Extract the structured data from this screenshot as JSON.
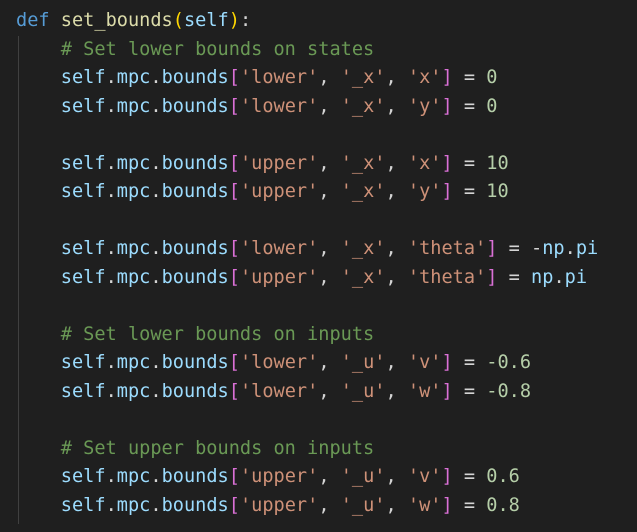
{
  "lines": [
    {
      "tokens": [
        {
          "text": "def",
          "type": "kw"
        },
        {
          "text": " ",
          "type": "plain"
        },
        {
          "text": "set_bounds",
          "type": "fn"
        },
        {
          "text": "(",
          "type": "bracket1"
        },
        {
          "text": "self",
          "type": "var"
        },
        {
          "text": ")",
          "type": "bracket1"
        },
        {
          "text": ":",
          "type": "plain"
        }
      ]
    },
    {
      "tokens": [
        {
          "text": "    # Set lower bounds on states",
          "type": "comment"
        }
      ]
    },
    {
      "tokens": [
        {
          "text": "    ",
          "type": "plain"
        },
        {
          "text": "self",
          "type": "var"
        },
        {
          "text": ".",
          "type": "plain"
        },
        {
          "text": "mpc",
          "type": "var"
        },
        {
          "text": ".",
          "type": "plain"
        },
        {
          "text": "bounds",
          "type": "var"
        },
        {
          "text": "[",
          "type": "bracket2"
        },
        {
          "text": "'lower'",
          "type": "str"
        },
        {
          "text": ", ",
          "type": "plain"
        },
        {
          "text": "'_x'",
          "type": "str"
        },
        {
          "text": ", ",
          "type": "plain"
        },
        {
          "text": "'x'",
          "type": "str"
        },
        {
          "text": "]",
          "type": "bracket2"
        },
        {
          "text": " = ",
          "type": "plain"
        },
        {
          "text": "0",
          "type": "num"
        }
      ]
    },
    {
      "tokens": [
        {
          "text": "    ",
          "type": "plain"
        },
        {
          "text": "self",
          "type": "var"
        },
        {
          "text": ".",
          "type": "plain"
        },
        {
          "text": "mpc",
          "type": "var"
        },
        {
          "text": ".",
          "type": "plain"
        },
        {
          "text": "bounds",
          "type": "var"
        },
        {
          "text": "[",
          "type": "bracket2"
        },
        {
          "text": "'lower'",
          "type": "str"
        },
        {
          "text": ", ",
          "type": "plain"
        },
        {
          "text": "'_x'",
          "type": "str"
        },
        {
          "text": ", ",
          "type": "plain"
        },
        {
          "text": "'y'",
          "type": "str"
        },
        {
          "text": "]",
          "type": "bracket2"
        },
        {
          "text": " = ",
          "type": "plain"
        },
        {
          "text": "0",
          "type": "num"
        }
      ]
    },
    {
      "tokens": []
    },
    {
      "tokens": [
        {
          "text": "    ",
          "type": "plain"
        },
        {
          "text": "self",
          "type": "var"
        },
        {
          "text": ".",
          "type": "plain"
        },
        {
          "text": "mpc",
          "type": "var"
        },
        {
          "text": ".",
          "type": "plain"
        },
        {
          "text": "bounds",
          "type": "var"
        },
        {
          "text": "[",
          "type": "bracket2"
        },
        {
          "text": "'upper'",
          "type": "str"
        },
        {
          "text": ", ",
          "type": "plain"
        },
        {
          "text": "'_x'",
          "type": "str"
        },
        {
          "text": ", ",
          "type": "plain"
        },
        {
          "text": "'x'",
          "type": "str"
        },
        {
          "text": "]",
          "type": "bracket2"
        },
        {
          "text": " = ",
          "type": "plain"
        },
        {
          "text": "10",
          "type": "num"
        }
      ]
    },
    {
      "tokens": [
        {
          "text": "    ",
          "type": "plain"
        },
        {
          "text": "self",
          "type": "var"
        },
        {
          "text": ".",
          "type": "plain"
        },
        {
          "text": "mpc",
          "type": "var"
        },
        {
          "text": ".",
          "type": "plain"
        },
        {
          "text": "bounds",
          "type": "var"
        },
        {
          "text": "[",
          "type": "bracket2"
        },
        {
          "text": "'upper'",
          "type": "str"
        },
        {
          "text": ", ",
          "type": "plain"
        },
        {
          "text": "'_x'",
          "type": "str"
        },
        {
          "text": ", ",
          "type": "plain"
        },
        {
          "text": "'y'",
          "type": "str"
        },
        {
          "text": "]",
          "type": "bracket2"
        },
        {
          "text": " = ",
          "type": "plain"
        },
        {
          "text": "10",
          "type": "num"
        }
      ]
    },
    {
      "tokens": []
    },
    {
      "tokens": [
        {
          "text": "    ",
          "type": "plain"
        },
        {
          "text": "self",
          "type": "var"
        },
        {
          "text": ".",
          "type": "plain"
        },
        {
          "text": "mpc",
          "type": "var"
        },
        {
          "text": ".",
          "type": "plain"
        },
        {
          "text": "bounds",
          "type": "var"
        },
        {
          "text": "[",
          "type": "bracket2"
        },
        {
          "text": "'lower'",
          "type": "str"
        },
        {
          "text": ", ",
          "type": "plain"
        },
        {
          "text": "'_x'",
          "type": "str"
        },
        {
          "text": ", ",
          "type": "plain"
        },
        {
          "text": "'theta'",
          "type": "str"
        },
        {
          "text": "]",
          "type": "bracket2"
        },
        {
          "text": " = -",
          "type": "plain"
        },
        {
          "text": "np",
          "type": "var"
        },
        {
          "text": ".",
          "type": "plain"
        },
        {
          "text": "pi",
          "type": "var"
        }
      ]
    },
    {
      "tokens": [
        {
          "text": "    ",
          "type": "plain"
        },
        {
          "text": "self",
          "type": "var"
        },
        {
          "text": ".",
          "type": "plain"
        },
        {
          "text": "mpc",
          "type": "var"
        },
        {
          "text": ".",
          "type": "plain"
        },
        {
          "text": "bounds",
          "type": "var"
        },
        {
          "text": "[",
          "type": "bracket2"
        },
        {
          "text": "'upper'",
          "type": "str"
        },
        {
          "text": ", ",
          "type": "plain"
        },
        {
          "text": "'_x'",
          "type": "str"
        },
        {
          "text": ", ",
          "type": "plain"
        },
        {
          "text": "'theta'",
          "type": "str"
        },
        {
          "text": "]",
          "type": "bracket2"
        },
        {
          "text": " = ",
          "type": "plain"
        },
        {
          "text": "np",
          "type": "var"
        },
        {
          "text": ".",
          "type": "plain"
        },
        {
          "text": "pi",
          "type": "var"
        }
      ]
    },
    {
      "tokens": []
    },
    {
      "tokens": [
        {
          "text": "    # Set lower bounds on inputs",
          "type": "comment"
        }
      ]
    },
    {
      "tokens": [
        {
          "text": "    ",
          "type": "plain"
        },
        {
          "text": "self",
          "type": "var"
        },
        {
          "text": ".",
          "type": "plain"
        },
        {
          "text": "mpc",
          "type": "var"
        },
        {
          "text": ".",
          "type": "plain"
        },
        {
          "text": "bounds",
          "type": "var"
        },
        {
          "text": "[",
          "type": "bracket2"
        },
        {
          "text": "'lower'",
          "type": "str"
        },
        {
          "text": ", ",
          "type": "plain"
        },
        {
          "text": "'_u'",
          "type": "str"
        },
        {
          "text": ", ",
          "type": "plain"
        },
        {
          "text": "'v'",
          "type": "str"
        },
        {
          "text": "]",
          "type": "bracket2"
        },
        {
          "text": " = ",
          "type": "plain"
        },
        {
          "text": "-0.6",
          "type": "num"
        }
      ]
    },
    {
      "tokens": [
        {
          "text": "    ",
          "type": "plain"
        },
        {
          "text": "self",
          "type": "var"
        },
        {
          "text": ".",
          "type": "plain"
        },
        {
          "text": "mpc",
          "type": "var"
        },
        {
          "text": ".",
          "type": "plain"
        },
        {
          "text": "bounds",
          "type": "var"
        },
        {
          "text": "[",
          "type": "bracket2"
        },
        {
          "text": "'lower'",
          "type": "str"
        },
        {
          "text": ", ",
          "type": "plain"
        },
        {
          "text": "'_u'",
          "type": "str"
        },
        {
          "text": ", ",
          "type": "plain"
        },
        {
          "text": "'w'",
          "type": "str"
        },
        {
          "text": "]",
          "type": "bracket2"
        },
        {
          "text": " = ",
          "type": "plain"
        },
        {
          "text": "-0.8",
          "type": "num"
        }
      ]
    },
    {
      "tokens": []
    },
    {
      "tokens": [
        {
          "text": "    # Set upper bounds on inputs",
          "type": "comment"
        }
      ]
    },
    {
      "tokens": [
        {
          "text": "    ",
          "type": "plain"
        },
        {
          "text": "self",
          "type": "var"
        },
        {
          "text": ".",
          "type": "plain"
        },
        {
          "text": "mpc",
          "type": "var"
        },
        {
          "text": ".",
          "type": "plain"
        },
        {
          "text": "bounds",
          "type": "var"
        },
        {
          "text": "[",
          "type": "bracket2"
        },
        {
          "text": "'upper'",
          "type": "str"
        },
        {
          "text": ", ",
          "type": "plain"
        },
        {
          "text": "'_u'",
          "type": "str"
        },
        {
          "text": ", ",
          "type": "plain"
        },
        {
          "text": "'v'",
          "type": "str"
        },
        {
          "text": "]",
          "type": "bracket2"
        },
        {
          "text": " = ",
          "type": "plain"
        },
        {
          "text": "0.6",
          "type": "num"
        }
      ]
    },
    {
      "tokens": [
        {
          "text": "    ",
          "type": "plain"
        },
        {
          "text": "self",
          "type": "var"
        },
        {
          "text": ".",
          "type": "plain"
        },
        {
          "text": "mpc",
          "type": "var"
        },
        {
          "text": ".",
          "type": "plain"
        },
        {
          "text": "bounds",
          "type": "var"
        },
        {
          "text": "[",
          "type": "bracket2"
        },
        {
          "text": "'upper'",
          "type": "str"
        },
        {
          "text": ", ",
          "type": "plain"
        },
        {
          "text": "'_u'",
          "type": "str"
        },
        {
          "text": ", ",
          "type": "plain"
        },
        {
          "text": "'w'",
          "type": "str"
        },
        {
          "text": "]",
          "type": "bracket2"
        },
        {
          "text": " = ",
          "type": "plain"
        },
        {
          "text": "0.8",
          "type": "num"
        }
      ]
    }
  ]
}
